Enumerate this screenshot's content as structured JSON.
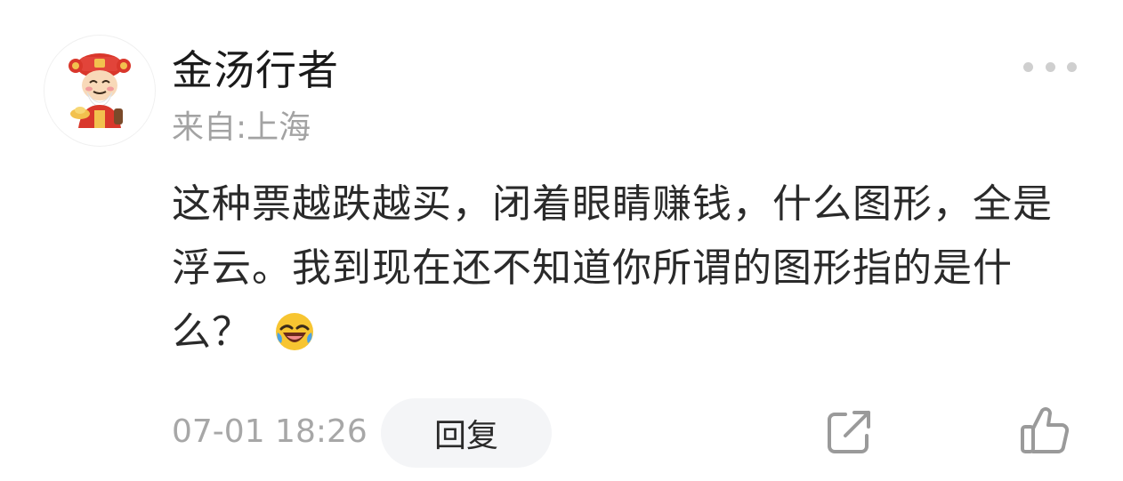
{
  "comment": {
    "username": "金汤行者",
    "location": "来自:上海",
    "text": "这种票越跌越买，闭着眼睛赚钱，什么图形，全是浮云。我到现在还不知道你所谓的图形指的是什么？",
    "emoji": "laughing-crying-emoji",
    "timestamp": "07-01 18:26",
    "reply_label": "回复",
    "avatar_icon": "caishen-avatar-icon",
    "more_icon": "more-dots-icon",
    "share_icon": "share-icon",
    "like_icon": "thumbs-up-icon"
  },
  "colors": {
    "text_primary": "#2a2a2a",
    "text_secondary": "#a3a3a3",
    "reply_bg": "#f4f5f7",
    "icon_gray": "#9a9a9a"
  }
}
